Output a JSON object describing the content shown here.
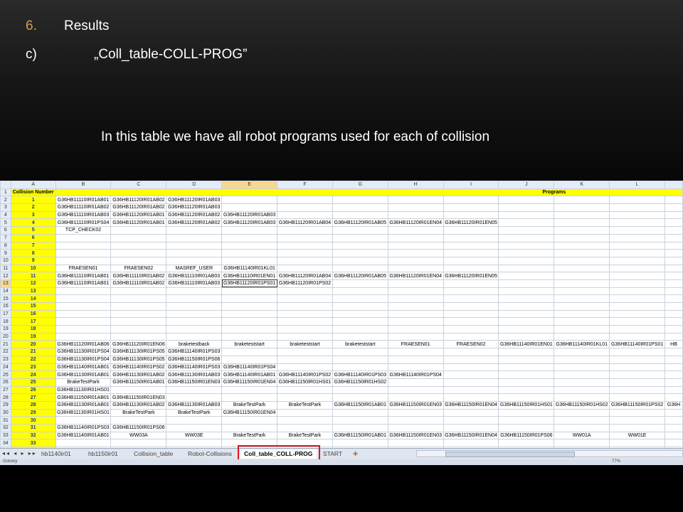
{
  "slide": {
    "number": "6.",
    "title": "Results",
    "sub_label": "c)",
    "sub_text": "„Coll_table-COLL-PROG”",
    "description": "In this table we have all robot programs used for each of collision"
  },
  "sheet": {
    "columns": [
      "A",
      "B",
      "C",
      "D",
      "E",
      "F",
      "G",
      "H",
      "I",
      "J",
      "K",
      "L",
      ""
    ],
    "selected_column": "E",
    "selected_row": "13",
    "header_row": {
      "row": "1",
      "a": "Collision Number",
      "programs": "Programs"
    },
    "rows": [
      {
        "r": "2",
        "n": "1",
        "c": [
          "G36HB11110IR01AB01",
          "G36HB11120IR01AB02",
          "G36HB11120IR01AB03",
          "",
          "",
          "",
          "",
          "",
          "",
          "",
          "",
          ""
        ]
      },
      {
        "r": "3",
        "n": "2",
        "c": [
          "G36HB11110IR01AB02",
          "G36HB11120IR01AB02",
          "G36HB11120IR01AB03",
          "",
          "",
          "",
          "",
          "",
          "",
          "",
          "",
          ""
        ]
      },
      {
        "r": "4",
        "n": "3",
        "c": [
          "G36HB11110IR01AB03",
          "G36HB11120IR01AB01",
          "G36HB11120IR01AB02",
          "G36HB11120IR01AB03",
          "",
          "",
          "",
          "",
          "",
          "",
          "",
          ""
        ]
      },
      {
        "r": "5",
        "n": "4",
        "c": [
          "G36HB11110IR01PS04",
          "G36HB11120IR01AB01",
          "G36HB11120IR01AB02",
          "G36HB11120IR01AB03",
          "G36HB11120IR01AB04",
          "G36HB11120IR01AB05",
          "G36HB11120IR01EN04",
          "G36HB11120IR01EN05",
          "",
          "",
          "",
          ""
        ]
      },
      {
        "r": "6",
        "n": "5",
        "c": [
          "TCP_CHECK02",
          "",
          "",
          "",
          "",
          "",
          "",
          "",
          "",
          "",
          "",
          ""
        ]
      },
      {
        "r": "7",
        "n": "6",
        "c": [
          "",
          "",
          "",
          "",
          "",
          "",
          "",
          "",
          "",
          "",
          "",
          ""
        ]
      },
      {
        "r": "8",
        "n": "7",
        "c": [
          "",
          "",
          "",
          "",
          "",
          "",
          "",
          "",
          "",
          "",
          "",
          ""
        ]
      },
      {
        "r": "9",
        "n": "8",
        "c": [
          "",
          "",
          "",
          "",
          "",
          "",
          "",
          "",
          "",
          "",
          "",
          ""
        ]
      },
      {
        "r": "10",
        "n": "9",
        "c": [
          "",
          "",
          "",
          "",
          "",
          "",
          "",
          "",
          "",
          "",
          "",
          ""
        ]
      },
      {
        "r": "11",
        "n": "10",
        "c": [
          "FRAESEN01",
          "FRAESEN02",
          "MASREF_USER",
          "G36HB11140IR01KL01",
          "",
          "",
          "",
          "",
          "",
          "",
          "",
          ""
        ]
      },
      {
        "r": "12",
        "n": "11",
        "c": [
          "G36HB11110IR01AB01",
          "G36HB11110IR01AB02",
          "G36HB11110IR01AB03",
          "G36HB11110IR01EN01",
          "G36HB11120IR01AB04",
          "G36HB11120IR01AB05",
          "G36HB11120IR01EN04",
          "G36HB11120IR01EN05",
          "",
          "",
          "",
          ""
        ]
      },
      {
        "r": "13",
        "n": "12",
        "c": [
          "G36HB11110IR01AB01",
          "G36HB11110IR01AB02",
          "G36HB11110IR01AB03",
          "G36HB11120IR01PS01",
          "G36HB11120IR01PS02",
          "",
          "",
          "",
          "",
          "",
          "",
          ""
        ]
      },
      {
        "r": "14",
        "n": "13",
        "c": [
          "",
          "",
          "",
          "",
          "",
          "",
          "",
          "",
          "",
          "",
          "",
          ""
        ]
      },
      {
        "r": "15",
        "n": "14",
        "c": [
          "",
          "",
          "",
          "",
          "",
          "",
          "",
          "",
          "",
          "",
          "",
          ""
        ]
      },
      {
        "r": "16",
        "n": "15",
        "c": [
          "",
          "",
          "",
          "",
          "",
          "",
          "",
          "",
          "",
          "",
          "",
          ""
        ]
      },
      {
        "r": "17",
        "n": "16",
        "c": [
          "",
          "",
          "",
          "",
          "",
          "",
          "",
          "",
          "",
          "",
          "",
          ""
        ]
      },
      {
        "r": "18",
        "n": "17",
        "c": [
          "",
          "",
          "",
          "",
          "",
          "",
          "",
          "",
          "",
          "",
          "",
          ""
        ]
      },
      {
        "r": "19",
        "n": "18",
        "c": [
          "",
          "",
          "",
          "",
          "",
          "",
          "",
          "",
          "",
          "",
          "",
          ""
        ]
      },
      {
        "r": "20",
        "n": "19",
        "c": [
          "",
          "",
          "",
          "",
          "",
          "",
          "",
          "",
          "",
          "",
          "",
          ""
        ]
      },
      {
        "r": "21",
        "n": "20",
        "c": [
          "G36HB11120IR01AB06",
          "G36HB11120IR01EN06",
          "braketestback",
          "braketeststart",
          "braketeststart",
          "braketeststart",
          "FRAESEN01",
          "FRAESEN02",
          "G36HB11140IR01EN01",
          "G36HB11140IR01KL01",
          "G36HB11140IR01PS01",
          "HB"
        ]
      },
      {
        "r": "22",
        "n": "21",
        "c": [
          "G36HB11130IR01PS04",
          "G36HB11130IR01PS05",
          "G36HB11140IR01PS03",
          "",
          "",
          "",
          "",
          "",
          "",
          "",
          "",
          ""
        ]
      },
      {
        "r": "23",
        "n": "22",
        "c": [
          "G36HB11130IR01PS04",
          "G36HB11130IR01PS05",
          "G36HB11150IR01PS06",
          "",
          "",
          "",
          "",
          "",
          "",
          "",
          "",
          ""
        ]
      },
      {
        "r": "24",
        "n": "23",
        "c": [
          "G36HB11140IR01AB01",
          "G36HB11140IR01PS02",
          "G36HB11140IR01PS03",
          "G36HB11140IR01PS04",
          "",
          "",
          "",
          "",
          "",
          "",
          "",
          ""
        ]
      },
      {
        "r": "25",
        "n": "24",
        "c": [
          "G36HB11130IR01AB01",
          "G36HB11130IR01AB02",
          "G36HB11130IR01AB03",
          "G36HB11140IR01AB01",
          "G36HB11140IR01PS02",
          "G36HB11140IR01PS03",
          "G36HB11140IR01PS04",
          "",
          "",
          "",
          "",
          ""
        ]
      },
      {
        "r": "26",
        "n": "25",
        "c": [
          "BrakeTestPark",
          "G36HB11150IR01AB01",
          "G36HB11150IR01EN03",
          "G36HB11150IR01EN04",
          "G36HB11150IR01HS01",
          "G36HB11150IR01HS02",
          "",
          "",
          "",
          "",
          "",
          ""
        ]
      },
      {
        "r": "27",
        "n": "26",
        "c": [
          "G36HB11130IR01HS01",
          "",
          "",
          "",
          "",
          "",
          "",
          "",
          "",
          "",
          "",
          ""
        ]
      },
      {
        "r": "28",
        "n": "27",
        "c": [
          "G36HB11150IR01AB01",
          "G36HB11150IR01EN03",
          "",
          "",
          "",
          "",
          "",
          "",
          "",
          "",
          "",
          ""
        ]
      },
      {
        "r": "29",
        "n": "28",
        "c": [
          "G36HB11130IR01AB01",
          "G36HB11130IR01AB02",
          "G36HB11130IR01AB03",
          "BrakeTestPark",
          "BrakeTestPark",
          "G36HB11150IR01AB01",
          "G36HB11150IR01EN03",
          "G36HB11150IR01EN04",
          "G36HB11150IR01HS01",
          "G36HB11150IR01HS02",
          "G36HB11150IR01PS02",
          "G36H"
        ]
      },
      {
        "r": "30",
        "n": "29",
        "c": [
          "G36HB11130IR01HS01",
          "BrakeTestPark",
          "BrakeTestPark",
          "G36HB11150IR01EN04",
          "",
          "",
          "",
          "",
          "",
          "",
          "",
          ""
        ]
      },
      {
        "r": "31",
        "n": "30",
        "c": [
          "",
          "",
          "",
          "",
          "",
          "",
          "",
          "",
          "",
          "",
          "",
          ""
        ]
      },
      {
        "r": "32",
        "n": "31",
        "c": [
          "G36HB11140IR01PS03",
          "G36HB11150IR01PS06",
          "",
          "",
          "",
          "",
          "",
          "",
          "",
          "",
          "",
          ""
        ]
      },
      {
        "r": "33",
        "n": "32",
        "c": [
          "G36HB11140IR01AB01",
          "WW03A",
          "WW03E",
          "BrakeTestPark",
          "BrakeTestPark",
          "G36HB11150IR01AB01",
          "G36HB11150IR01EN03",
          "G36HB11150IR01EN04",
          "G36HB11150IR01PS06",
          "WW01A",
          "WW01E",
          ""
        ]
      },
      {
        "r": "34",
        "n": "33",
        "c": [
          "",
          "",
          "",
          "",
          "",
          "",
          "",
          "",
          "",
          "",
          "",
          ""
        ]
      },
      {
        "r": "35",
        "n": "",
        "c": [
          "",
          "",
          "",
          "",
          "",
          "",
          "",
          "",
          "",
          "",
          "",
          ""
        ]
      }
    ]
  },
  "tabs": {
    "nav_arrows": "◂◂ ◂ ▸ ▸▸",
    "items": [
      "hb1140ir01",
      "hb1150ir01",
      "Collision_table",
      "Robot-Collisions",
      "Coll_table_COLL-PROG",
      "START"
    ],
    "active": "Coll_table_COLL-PROG"
  },
  "status": {
    "left": "Gotowy",
    "zoom": "77%"
  }
}
